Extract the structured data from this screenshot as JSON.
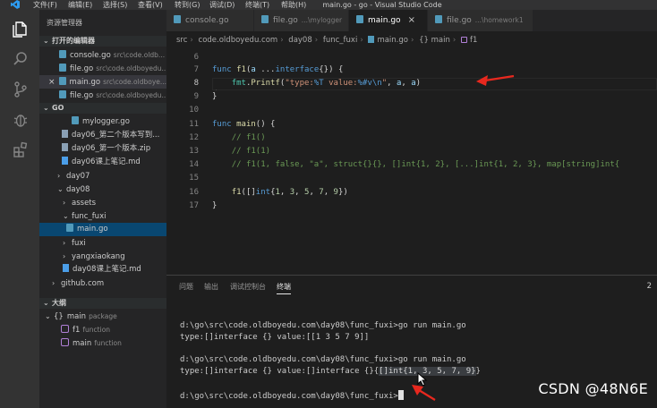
{
  "titlebar": {
    "menus": [
      "文件(F)",
      "编辑(E)",
      "选择(S)",
      "查看(V)",
      "转到(G)",
      "调试(D)",
      "终端(T)",
      "帮助(H)"
    ],
    "window_title": "main.go - go - Visual Studio Code"
  },
  "activitybar": {
    "icons": [
      "files-icon",
      "search-icon",
      "source-control-icon",
      "debug-icon",
      "extensions-icon"
    ]
  },
  "sidebar": {
    "title": "资源管理器",
    "open_editors": {
      "header": "打开的编辑器",
      "items": [
        {
          "name": "console.go",
          "path": "src\\code.oldb..."
        },
        {
          "name": "file.go",
          "path": "src\\code.oldboyedu..."
        },
        {
          "name": "main.go",
          "path": "src\\code.oldboye..."
        },
        {
          "name": "file.go",
          "path": "src\\code.oldboyedu..."
        }
      ]
    },
    "folder": {
      "header": "GO",
      "items": [
        {
          "label": "mylogger.go",
          "icon": "go"
        },
        {
          "label": "day06_第二个版本写到...",
          "icon": "doc"
        },
        {
          "label": "day06_第一个版本.zip",
          "icon": "doc"
        },
        {
          "label": "day06课上笔记.md",
          "icon": "md"
        },
        {
          "label": "day07",
          "icon": "folder-closed"
        },
        {
          "label": "day08",
          "icon": "folder-open"
        },
        {
          "label": "assets",
          "icon": "folder-closed"
        },
        {
          "label": "func_fuxi",
          "icon": "folder-open"
        },
        {
          "label": "main.go",
          "icon": "go"
        },
        {
          "label": "fuxi",
          "icon": "folder-closed"
        },
        {
          "label": "yangxiaokang",
          "icon": "folder-closed"
        },
        {
          "label": "day08课上笔记.md",
          "icon": "md"
        },
        {
          "label": "github.com",
          "icon": "folder-closed"
        }
      ]
    },
    "outline": {
      "header": "大纲",
      "items": [
        {
          "label": "main",
          "kind": "package"
        },
        {
          "label": "f1",
          "kind": "function"
        },
        {
          "label": "main",
          "kind": "function"
        }
      ]
    }
  },
  "tabs": [
    {
      "name": "console.go",
      "path": ""
    },
    {
      "name": "file.go",
      "path": "...\\mylogger"
    },
    {
      "name": "main.go",
      "path": "",
      "close": "×"
    },
    {
      "name": "file.go",
      "path": "...\\homework1"
    }
  ],
  "breadcrumb": [
    "src",
    "code.oldboyedu.com",
    "day08",
    "func_fuxi",
    "main.go",
    "{} main",
    "f1"
  ],
  "editor": {
    "line_numbers": [
      "6",
      "7",
      "8",
      "9",
      "10",
      "11",
      "12",
      "13",
      "14",
      "15",
      "16",
      "17"
    ],
    "current_line": "8"
  },
  "panel": {
    "tabs": [
      "问题",
      "输出",
      "调试控制台",
      "终端"
    ],
    "active_tab": "终端",
    "terminal_number": "2",
    "terminal_lines": [
      "d:\\go\\src\\code.oldboyedu.com\\day08\\func_fuxi>go run main.go",
      "type:[]interface {} value:[[1 3 5 7 9]]",
      "d:\\go\\src\\code.oldboyedu.com\\day08\\func_fuxi>go run main.go",
      "type:[]interface {} value:[]interface {}{",
      "[]int{1, 3, 5, 7, 9}",
      "}",
      "d:\\go\\src\\code.oldboyedu.com\\day08\\func_fuxi>"
    ]
  },
  "watermark": "CSDN @48N6E",
  "colors": {
    "annotation_arrow": "#e8281e",
    "accent": "#007acc"
  }
}
